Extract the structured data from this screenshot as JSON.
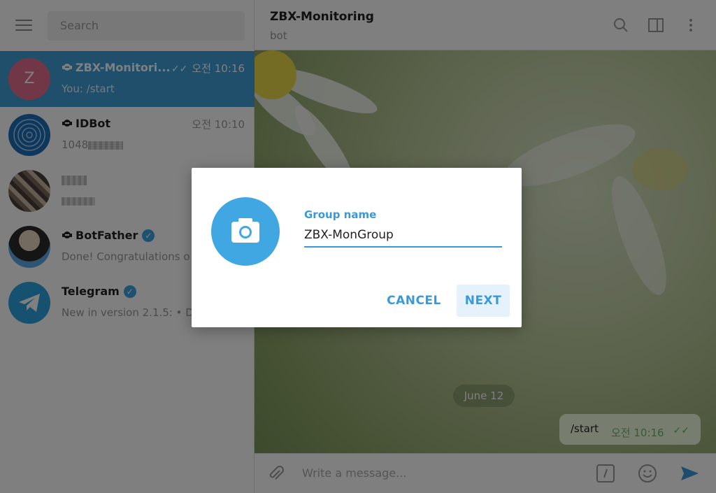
{
  "sidebar": {
    "search_placeholder": "Search",
    "chats": [
      {
        "name": "ZBX-Monitori...",
        "time": "오전 10:16",
        "preview": "You: /start",
        "initial": "Z",
        "avatar_color": "#e26f8f",
        "active": true,
        "is_bot": true
      },
      {
        "name": "IDBot",
        "time": "오전 10:10",
        "preview": "1048",
        "is_bot": true
      },
      {
        "name": "",
        "preview": ""
      },
      {
        "name": "BotFather",
        "preview": "Done! Congratulations o",
        "is_bot": true,
        "verified": true
      },
      {
        "name": "Telegram",
        "preview": "New in version 2.1.5: • D",
        "verified": true
      }
    ]
  },
  "header": {
    "title": "ZBX-Monitoring",
    "subtitle": "bot"
  },
  "chat_area": {
    "date_label": "June 12",
    "message": {
      "text": "/start",
      "time": "오전 10:16"
    }
  },
  "compose": {
    "placeholder": "Write a message..."
  },
  "dialog": {
    "field_label": "Group name",
    "field_value": "ZBX-MonGroup",
    "cancel_label": "CANCEL",
    "next_label": "NEXT"
  },
  "colors": {
    "accent": "#3a9ad9",
    "active_chat": "#419fd9",
    "photo_button": "#40a7e3"
  }
}
